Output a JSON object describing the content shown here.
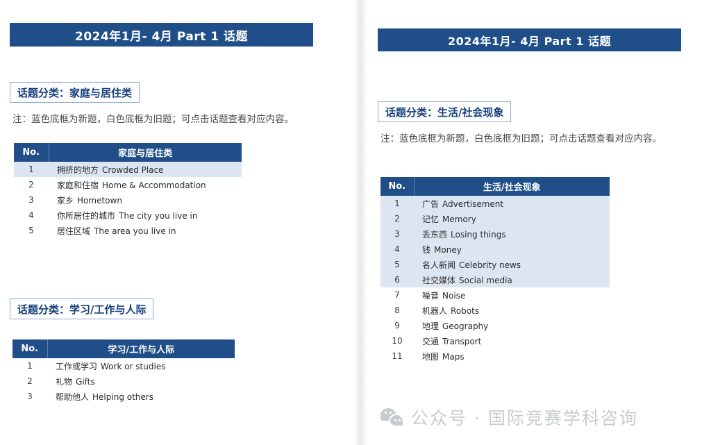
{
  "pages": {
    "left": {
      "banner_title": "2024年1月- 4月  Part 1  话题",
      "note": "注：蓝色底框为新题，白色底框为旧题；可点击话题查看对应内容。",
      "sections": [
        {
          "category_label": "话题分类：家庭与居住类",
          "table": {
            "header_no": "No.",
            "header_topic": "家庭与居住类",
            "rows": [
              {
                "no": "1",
                "cn": "拥挤的地方",
                "en": "Crowded Place",
                "highlight": true
              },
              {
                "no": "2",
                "cn": "家庭和住宿",
                "en": "Home & Accommodation",
                "highlight": false
              },
              {
                "no": "3",
                "cn": "家乡",
                "en": "Hometown",
                "highlight": false
              },
              {
                "no": "4",
                "cn": "你所居住的城市",
                "en": "The city you live in",
                "highlight": false
              },
              {
                "no": "5",
                "cn": "居住区域",
                "en": "The area you live in",
                "highlight": false
              }
            ]
          }
        },
        {
          "category_label": "话题分类：学习/工作与人际",
          "table": {
            "header_no": "No.",
            "header_topic": "学习/工作与人际",
            "rows": [
              {
                "no": "1",
                "cn": "工作或学习",
                "en": "Work or studies",
                "highlight": false
              },
              {
                "no": "2",
                "cn": "礼物",
                "en": "Gifts",
                "highlight": false
              },
              {
                "no": "3",
                "cn": "帮助他人",
                "en": "Helping others",
                "highlight": false
              }
            ]
          }
        }
      ]
    },
    "right": {
      "banner_title": "2024年1月- 4月  Part 1  话题",
      "note": "注：蓝色底框为新题，白色底框为旧题；可点击话题查看对应内容。",
      "sections": [
        {
          "category_label": "话题分类：生活/社会现象",
          "table": {
            "header_no": "No.",
            "header_topic": "生活/社会现象",
            "rows": [
              {
                "no": "1",
                "cn": "广告",
                "en": "Advertisement",
                "highlight": true
              },
              {
                "no": "2",
                "cn": "记忆",
                "en": "Memory",
                "highlight": true
              },
              {
                "no": "3",
                "cn": "丢东西",
                "en": "Losing things",
                "highlight": true
              },
              {
                "no": "4",
                "cn": "钱",
                "en": "Money",
                "highlight": true
              },
              {
                "no": "5",
                "cn": "名人新闻",
                "en": "Celebrity news",
                "highlight": true
              },
              {
                "no": "6",
                "cn": "社交媒体",
                "en": "Social media",
                "highlight": true
              },
              {
                "no": "7",
                "cn": "噪音",
                "en": "Noise",
                "highlight": false
              },
              {
                "no": "8",
                "cn": "机器人",
                "en": "Robots",
                "highlight": false
              },
              {
                "no": "9",
                "cn": "地理",
                "en": "Geography",
                "highlight": false
              },
              {
                "no": "10",
                "cn": "交通",
                "en": "Transport",
                "highlight": false
              },
              {
                "no": "11",
                "cn": "地图",
                "en": "Maps",
                "highlight": false
              }
            ]
          }
        }
      ],
      "footer": {
        "icon": "wechat-icon",
        "text": "公众号 · 国际竞赛学科咨询"
      }
    }
  },
  "colors": {
    "banner_blue": "#1f4e88",
    "row_highlight": "#dce6f2",
    "chip_border": "#8ba7cc",
    "chip_text": "#17407c",
    "watermark_gray": "#c9cccd"
  }
}
